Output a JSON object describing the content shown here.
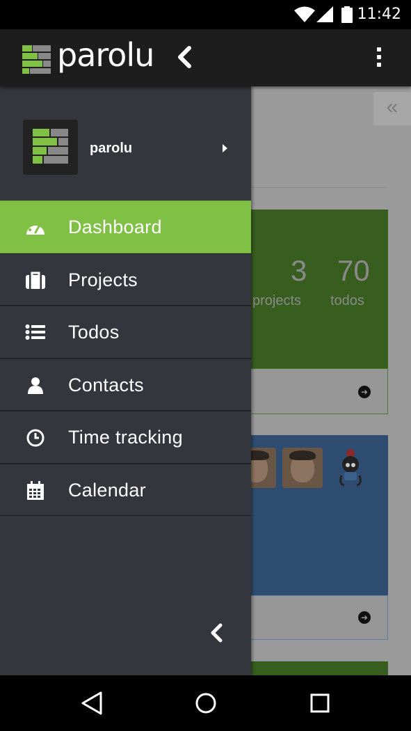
{
  "status_bar": {
    "time": "11:42"
  },
  "app_bar": {
    "brand": "parolu"
  },
  "drawer": {
    "profile_name": "parolu",
    "menu": [
      {
        "label": "Dashboard",
        "icon": "dashboard-icon",
        "active": true
      },
      {
        "label": "Projects",
        "icon": "briefcase-icon",
        "active": false
      },
      {
        "label": "Todos",
        "icon": "list-icon",
        "active": false
      },
      {
        "label": "Contacts",
        "icon": "user-icon",
        "active": false
      },
      {
        "label": "Time tracking",
        "icon": "clock-icon",
        "active": false
      },
      {
        "label": "Calendar",
        "icon": "calendar-icon",
        "active": false
      }
    ]
  },
  "background": {
    "stats": [
      {
        "value": "3",
        "label": "projects"
      },
      {
        "value": "70",
        "label": "todos"
      }
    ]
  },
  "colors": {
    "accent": "#80c145",
    "drawer_bg": "#34363d",
    "appbar_bg": "#1d1d1d"
  }
}
